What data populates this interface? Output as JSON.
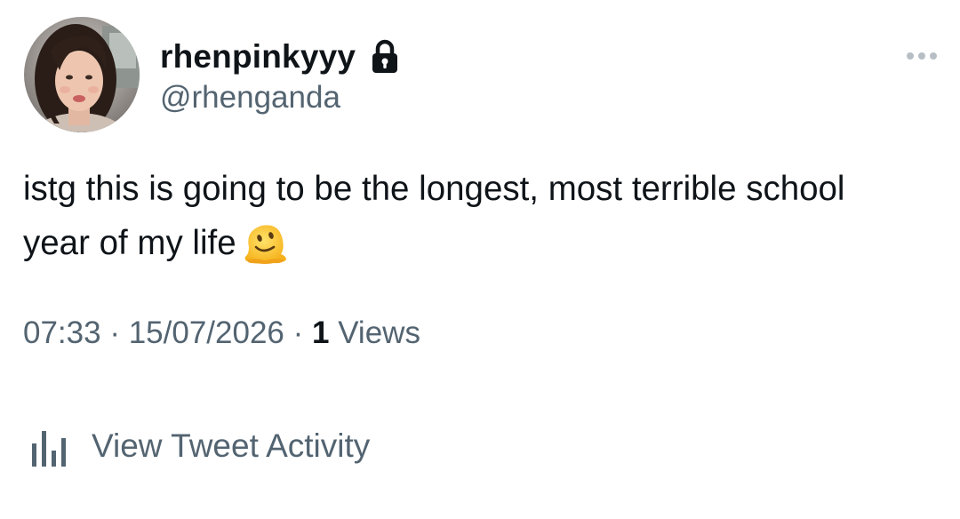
{
  "author": {
    "display_name": "rhenpinkyyy",
    "handle": "@rhenganda",
    "protected_icon": "lock-icon",
    "avatar_icon": "profile-photo"
  },
  "tweet": {
    "text": "istg this is going to be the longest, most terrible school year of my life",
    "emoji": "melting-face-emoji"
  },
  "meta": {
    "time": "07:33",
    "separator": "·",
    "date": "15/07/2026",
    "views_count": "1",
    "views_label": "Views"
  },
  "actions": {
    "more_icon": "more-horizontal-icon",
    "activity_icon": "bar-chart-icon",
    "activity_label": "View Tweet Activity"
  },
  "colors": {
    "text_primary": "#0f1419",
    "text_secondary": "#536471",
    "background": "#ffffff"
  }
}
